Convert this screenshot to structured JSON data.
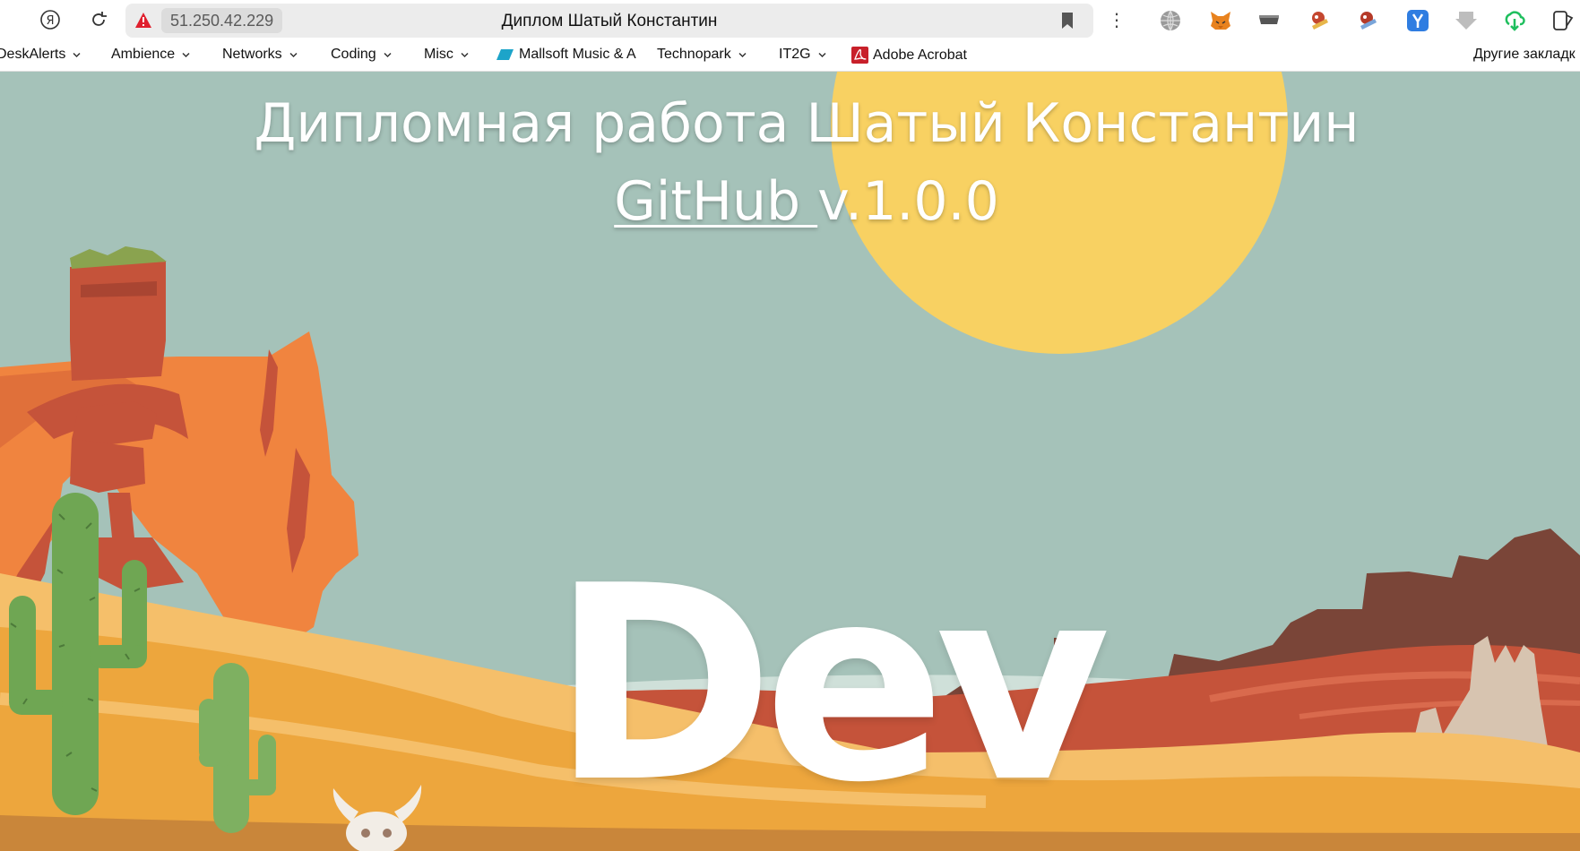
{
  "browser": {
    "address": "51.250.42.229",
    "tab_title": "Диплом Шатый Константин",
    "kebab": "⋮"
  },
  "bookmarks": {
    "items": [
      {
        "label": "DeskAlerts",
        "has_menu": true
      },
      {
        "label": "Ambience",
        "has_menu": true
      },
      {
        "label": "Networks",
        "has_menu": true
      },
      {
        "label": "Coding",
        "has_menu": true
      },
      {
        "label": "Misc",
        "has_menu": true
      },
      {
        "label": "Mallsoft Music & A",
        "has_menu": false
      },
      {
        "label": "Technopark",
        "has_menu": true
      },
      {
        "label": "IT2G",
        "has_menu": true
      },
      {
        "label": "Adobe Acrobat",
        "has_menu": false
      }
    ],
    "other": "Другие закладк"
  },
  "page": {
    "title": "Дипломная работа Шатый Константин",
    "github_link": "GitHub ",
    "version": "v.1.0.0",
    "dev_text": "Dev"
  },
  "colors": {
    "sky": "#a5c2b9",
    "sun": "#f8d162",
    "sand_light": "#f5bf6a",
    "sand": "#eda63d",
    "rock_orange": "#f0843f",
    "rock_red": "#c5533a",
    "mesa_brown": "#7a4538",
    "cactus": "#6fa653",
    "pdf_red": "#c8202a"
  },
  "icons": [
    "yandex-icon",
    "reload-icon",
    "warning-icon",
    "bookmark-icon",
    "globe-icon",
    "fox-icon",
    "drive-icon",
    "addon-icon",
    "addon-icon",
    "y-icon",
    "download-icon",
    "cloud-icon",
    "collections-icon"
  ]
}
